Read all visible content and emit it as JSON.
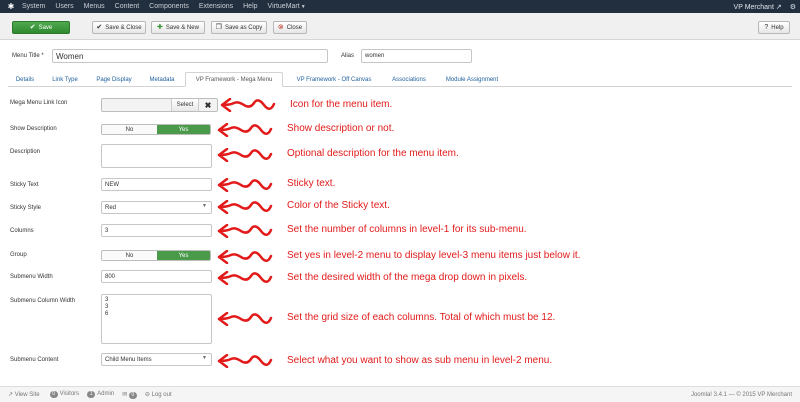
{
  "navbar": {
    "logo_icon": "joomla-icon",
    "items": [
      "System",
      "Users",
      "Menus",
      "Content",
      "Components",
      "Extensions",
      "Help",
      "VirtueMart"
    ],
    "site_name": "VP Merchant",
    "external_icon": "external-link-icon",
    "settings_icon": "gear-icon"
  },
  "toolbar": {
    "save": "Save",
    "save_close": "Save & Close",
    "save_new": "Save & New",
    "save_copy": "Save as Copy",
    "close": "Close",
    "help": "Help"
  },
  "header": {
    "menu_title_label": "Menu Title *",
    "menu_title_value": "Women",
    "alias_label": "Alias",
    "alias_value": "women"
  },
  "tabs": [
    "Details",
    "Link Type",
    "Page Display",
    "Metadata",
    "VP Framework - Mega Menu",
    "VP Framework - Off Canvas",
    "Associations",
    "Module Assignment"
  ],
  "active_tab": "VP Framework - Mega Menu",
  "form": {
    "mega_menu_link_icon": {
      "label": "Mega Menu Link Icon",
      "select": "Select",
      "clear": "✖"
    },
    "show_description": {
      "label": "Show Description",
      "no": "No",
      "yes": "Yes"
    },
    "description": {
      "label": "Description",
      "value": ""
    },
    "sticky_text": {
      "label": "Sticky Text",
      "value": "NEW"
    },
    "sticky_style": {
      "label": "Sticky Style",
      "value": "Red"
    },
    "columns": {
      "label": "Columns",
      "value": "3"
    },
    "group": {
      "label": "Group",
      "no": "No",
      "yes": "Yes"
    },
    "submenu_width": {
      "label": "Submenu Width",
      "value": "800"
    },
    "submenu_column_width": {
      "label": "Submenu Column Width",
      "lines": [
        "3",
        "3",
        "6"
      ]
    },
    "submenu_content": {
      "label": "Submenu Content",
      "value": "Child Menu Items"
    }
  },
  "annotations": [
    "Icon for the menu item.",
    "Show description or not.",
    "Optional description for the menu item.",
    "Sticky text.",
    "Color of the Sticky text.",
    "Set the number of columns in level-1 for its sub-menu.",
    "Set yes in level-2 menu to display level-3 menu items just below it.",
    "Set the desired width of the mega drop down in pixels.",
    "Set the grid size of each columns. Total of which must be 12.",
    "Select what you want to show as sub menu in level-2 menu."
  ],
  "footer": {
    "view_site": "View Site",
    "visitors_count": "0",
    "visitors": "Visitors",
    "admin_count": "1",
    "admin": "Admin",
    "messages_count": "0",
    "logout": "Log out",
    "version": "Joomla! 3.4.1 — © 2015 VP Merchant"
  },
  "colors": {
    "navbar": "#222f3f",
    "accent_green": "#4a9a4a",
    "annotation_red": "#e21a1a",
    "link_blue": "#1f5f9c"
  }
}
